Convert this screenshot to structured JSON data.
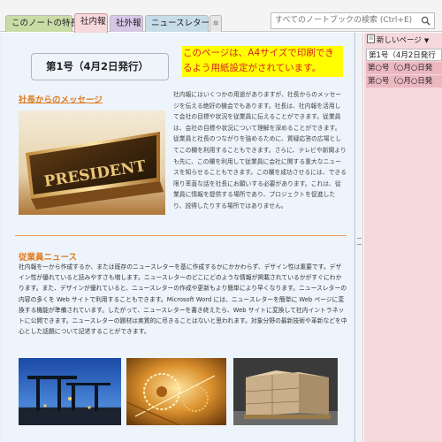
{
  "tabs": [
    {
      "label": "このノートの特長"
    },
    {
      "label": "社内報"
    },
    {
      "label": "社外報"
    },
    {
      "label": "ニュースレター"
    },
    {
      "label": "✲"
    }
  ],
  "search": {
    "placeholder": "すべてのノートブックの検索 (Ctrl+E)",
    "icon": "search-icon"
  },
  "page": {
    "title": "第1号（4月2日発行）",
    "note": "このページは、A4サイズで印刷できるよう用紙設定がされています。",
    "section1": {
      "heading": "社長からのメッセージ",
      "image_text": "PRESIDENT",
      "paragraph": "社内報にはいくつかの用途がありますが、社長からのメッセージを伝える絶好の機会でもあります。社長は、社内報を活用して会社の目標や状況を従業員に伝えることができます。従業員は、会社の目標や状況について理解を深めることができます。従業員と社長のつながりを強めるために、質疑応答の広場としてこの欄を利用することもできます。さらに、テレビや新聞よりも先に、この欄を利用して従業員に会社に関する重大なニュースを知らせることもできます。この欄を成功させるには、できる限り率直な話を社長にお願いする必要があります。これは、従業員に情報を提供する場所であり、プロジェクトを促進したり、説得したりする場所ではありません。"
    },
    "section2": {
      "heading": "従業員ニュース",
      "paragraph": "社内報を一から作成するか、または既存のニュースレターを基に作成するかにかかわらず、デザイン性は重要です。デザイン性が優れていると読みやすさも増します。ニュースレターのどこにどのような情報が掲載されているかがすぐにわかります。また、デザインが優れていると、ニュースレターの作成や更新もより簡単により早くなります。ニュースレターの内容の多くを Web サイトで利用することもできます。Microsoft Word には、ニュースレターを簡単に Web ページに変換する機能が準備されています。したがって、ニュースレターを書き終えたら、Web サイトに変換して社内イントラネットに公開できます。ニュースレターの題材は実質的に尽きることはないと思われます。対象分野の最新技術や革新などを中心とした話題について記述することができます。"
    }
  },
  "sidebar": {
    "new_page": "新しいページ",
    "new_page_icon": "new-page-icon",
    "caret": "▼",
    "items": [
      {
        "label": "第1号（4月2日発行"
      },
      {
        "label": "第○号（○月○日発"
      },
      {
        "label": "第○号（○月○日発"
      }
    ]
  },
  "colors": {
    "page_background": "#edf4fb",
    "heading_orange": "#e07a20",
    "note_highlight": "#ffff00",
    "note_text": "#d82020",
    "section_tab_active": "#f7d8dc"
  }
}
